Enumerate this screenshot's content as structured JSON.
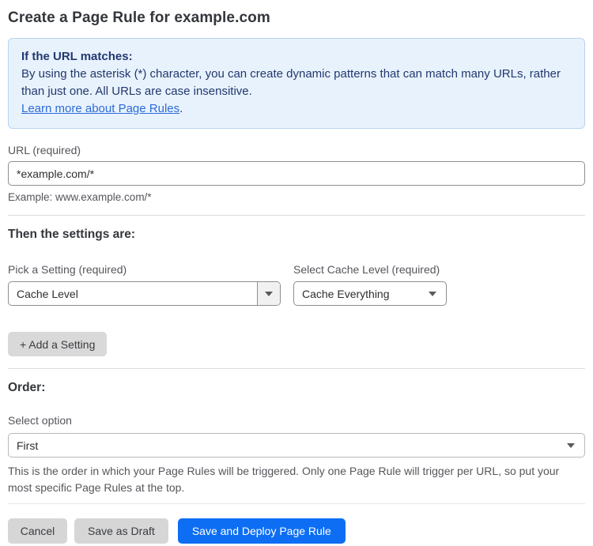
{
  "page": {
    "title": "Create a Page Rule for example.com"
  },
  "info_box": {
    "heading": "If the URL matches:",
    "body": "By using the asterisk (*) character, you can create dynamic patterns that can match many URLs, rather than just one. All URLs are case insensitive.",
    "link_label": "Learn more about Page Rules",
    "link_suffix": "."
  },
  "url_field": {
    "label": "URL (required)",
    "value": "*example.com/*",
    "helper": "Example: www.example.com/*"
  },
  "settings_section": {
    "heading": "Then the settings are:",
    "setting_picker": {
      "label": "Pick a Setting (required)",
      "selected_value": "Cache Level"
    },
    "cache_level_picker": {
      "label": "Select Cache Level (required)",
      "selected_value": "Cache Everything"
    },
    "add_setting_label": "+ Add a Setting"
  },
  "order_section": {
    "heading": "Order:",
    "label": "Select option",
    "selected_value": "First",
    "helper": "This is the order in which your Page Rules will be triggered. Only one Page Rule will trigger per URL, so put your most specific Page Rules at the top."
  },
  "actions": {
    "cancel_label": "Cancel",
    "save_draft_label": "Save as Draft",
    "save_deploy_label": "Save and Deploy Page Rule"
  },
  "icons": {
    "dropdown_arrow": "chevron-down-icon"
  },
  "colors": {
    "accent_blue": "#0d6ef4",
    "info_background": "#e8f2fd",
    "info_border": "#b9d3ef",
    "info_text": "#22386e",
    "link_blue": "#2d6bd9",
    "button_gray": "#d6d6d6"
  }
}
